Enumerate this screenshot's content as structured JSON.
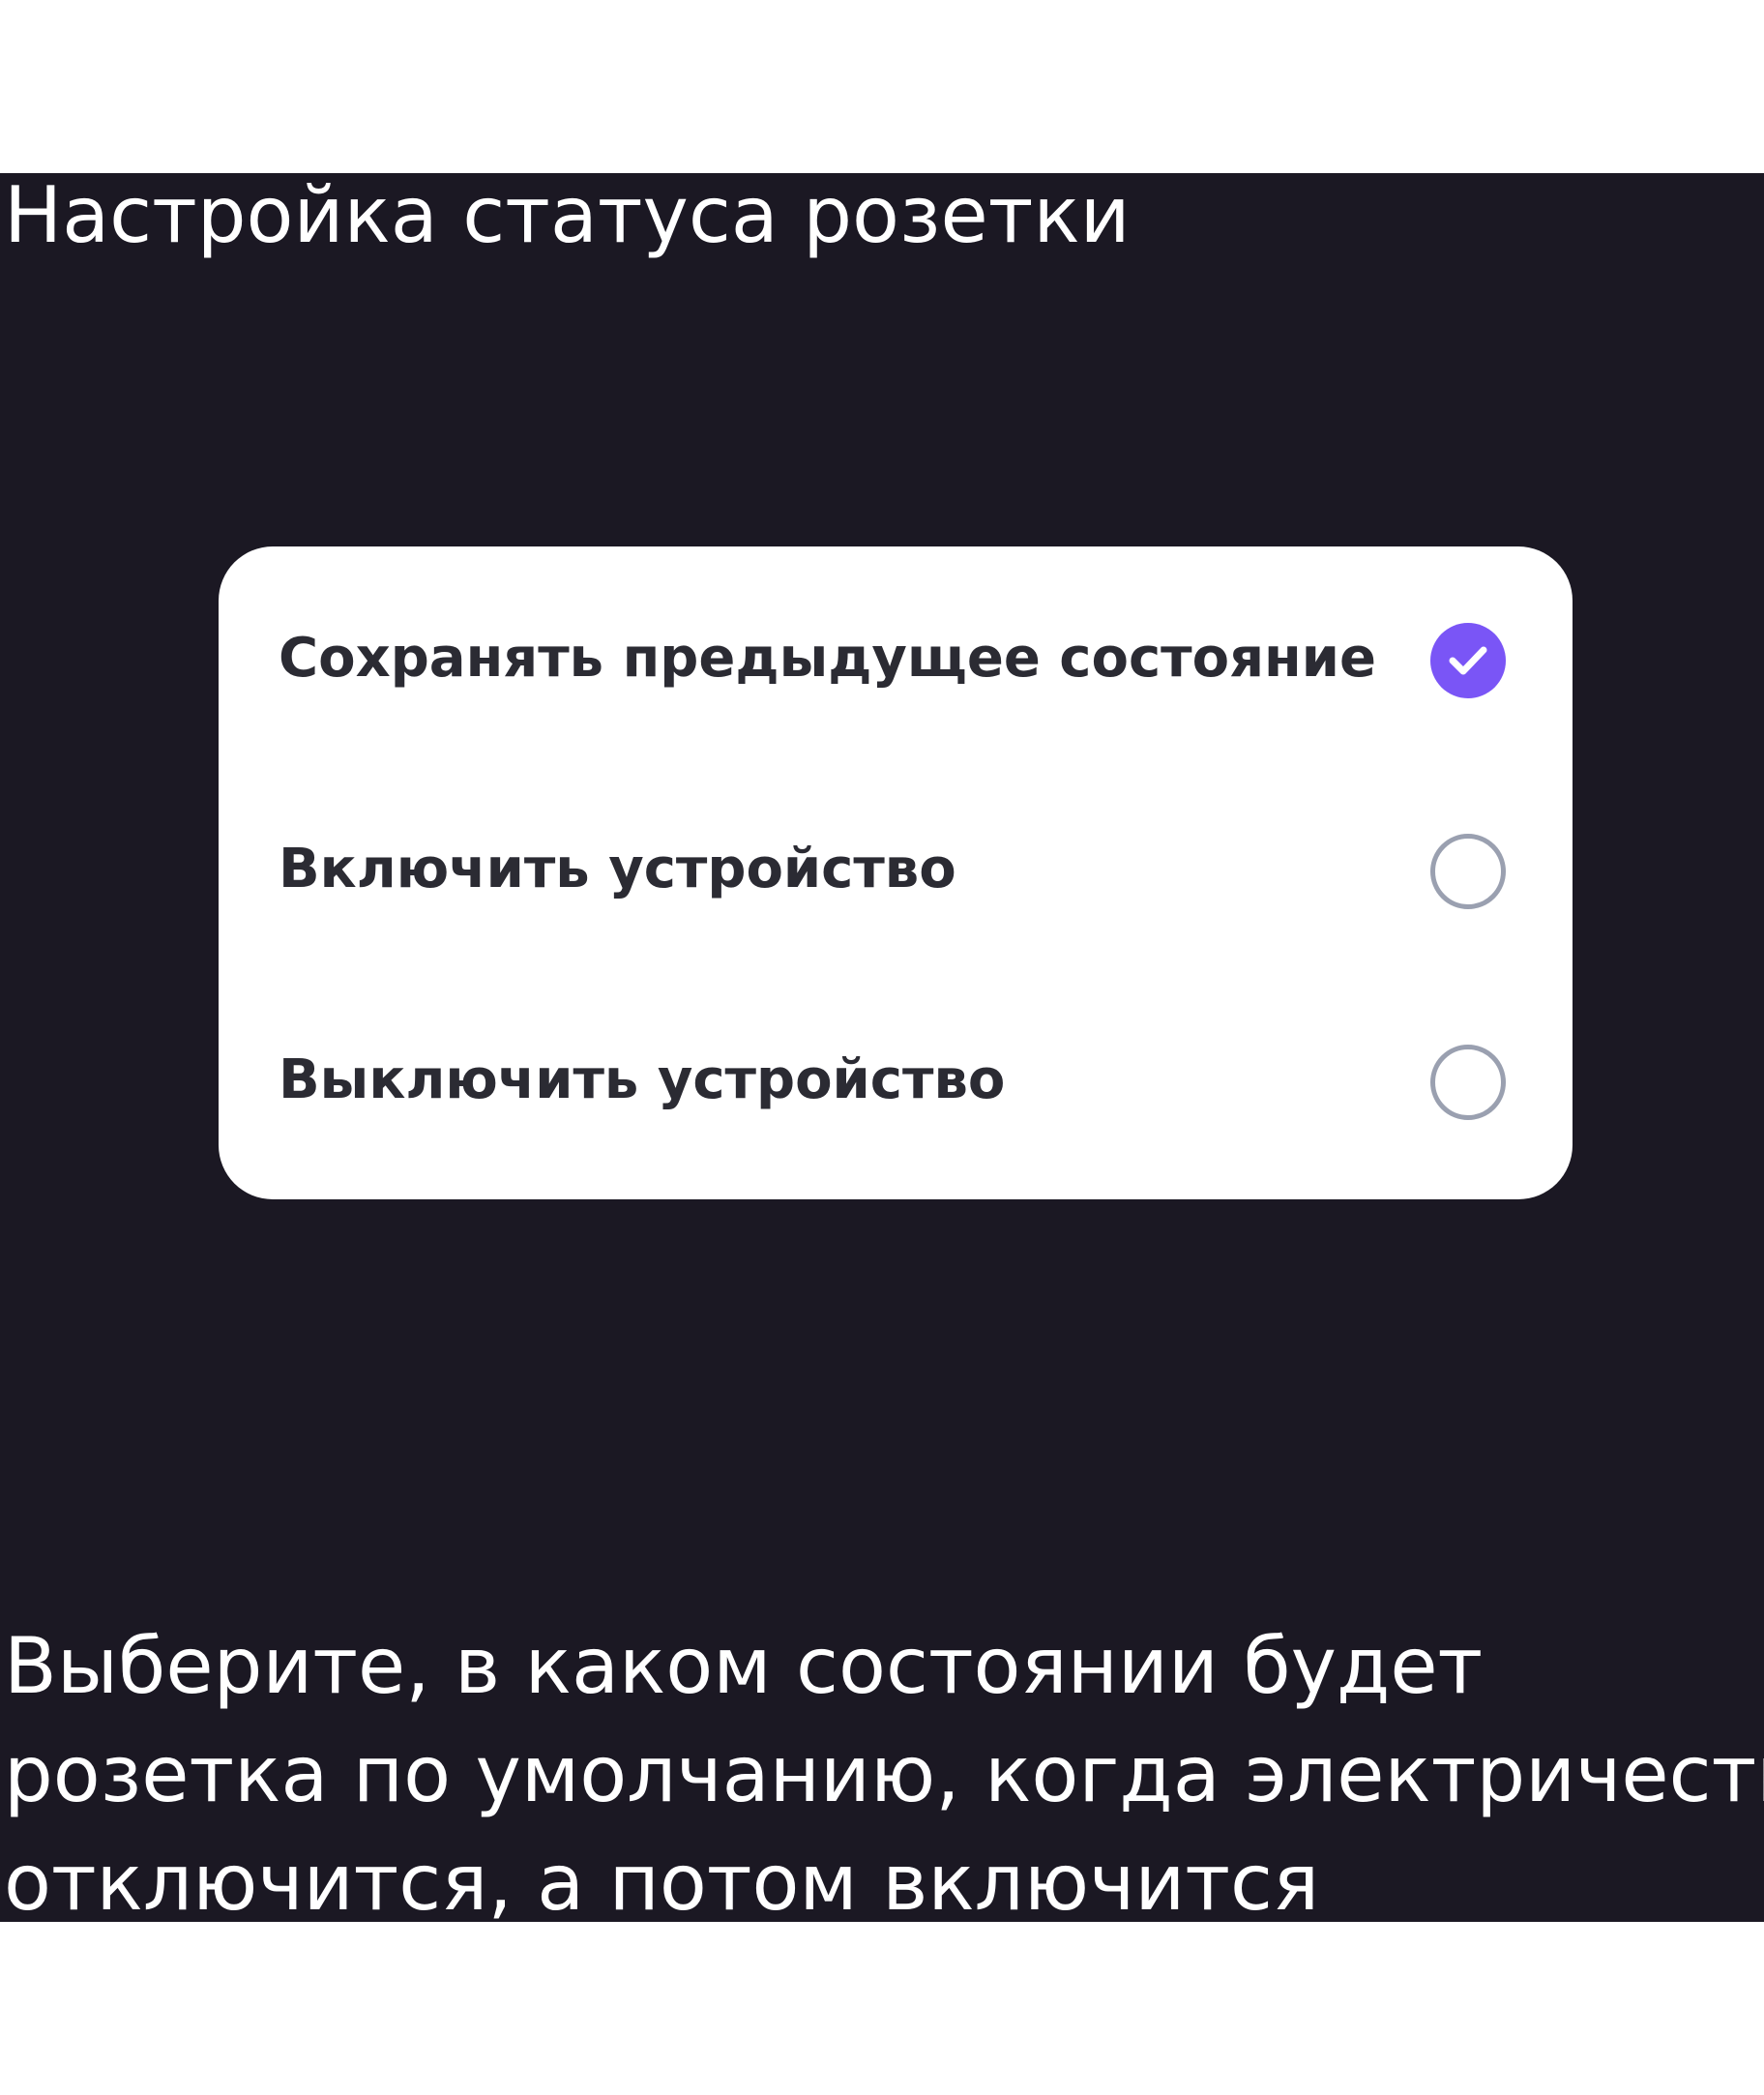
{
  "screen": {
    "title": "Настройка статуса розетки",
    "options": [
      {
        "label": "Сохранять предыдущее состояние",
        "selected": true
      },
      {
        "label": "Включить устройство",
        "selected": false
      },
      {
        "label": "Выключить устройство",
        "selected": false
      }
    ],
    "description_lines": [
      "Выберите, в каком состоянии будет",
      "розетка по умолчанию, когда электричество",
      "отключится, а потом включится"
    ]
  },
  "colors": {
    "panel_background": "#1b1823",
    "page_background": "#ffffff",
    "card_background": "#ffffff",
    "accent": "#7a55f6",
    "radio_border": "#9aa0b0",
    "option_text": "#2b2b33",
    "title_text": "#ffffff"
  },
  "icons": {
    "selected": "check-icon",
    "unselected": "radio-empty-icon"
  }
}
